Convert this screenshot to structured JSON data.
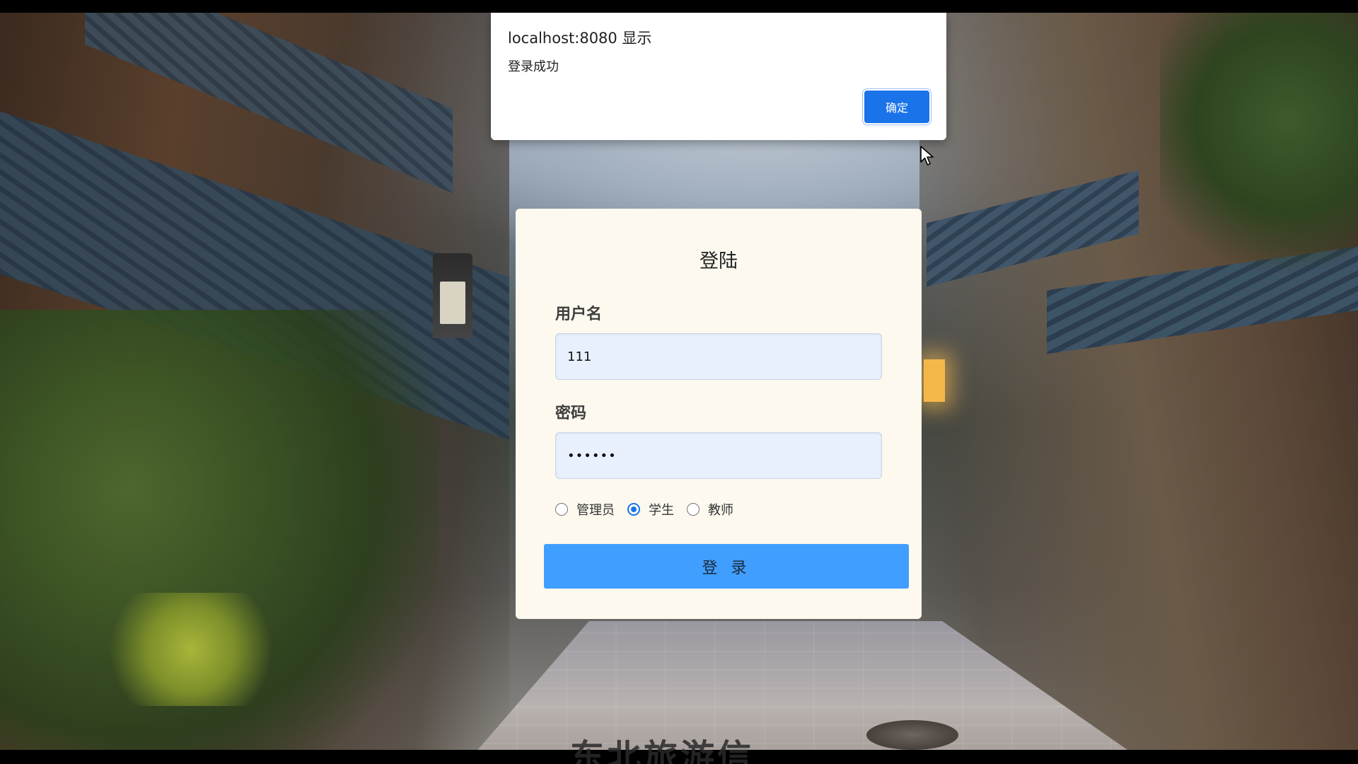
{
  "dialog": {
    "title": "localhost:8080 显示",
    "message": "登录成功",
    "ok_label": "确定"
  },
  "login": {
    "title": "登陆",
    "username_label": "用户名",
    "username_value": "111",
    "password_label": "密码",
    "password_value": "••••••",
    "roles": [
      {
        "label": "管理员",
        "checked": false
      },
      {
        "label": "学生",
        "checked": true
      },
      {
        "label": "教师",
        "checked": false
      }
    ],
    "submit_label": "登 录"
  },
  "background": {
    "bottom_caption": "东北旅游信"
  },
  "colors": {
    "primary": "#409eff",
    "dialog_button": "#1a73e8",
    "card_bg": "#fdf9ee",
    "input_bg": "#e8f0fe"
  },
  "icons": {
    "cursor": "mouse-pointer-icon"
  }
}
